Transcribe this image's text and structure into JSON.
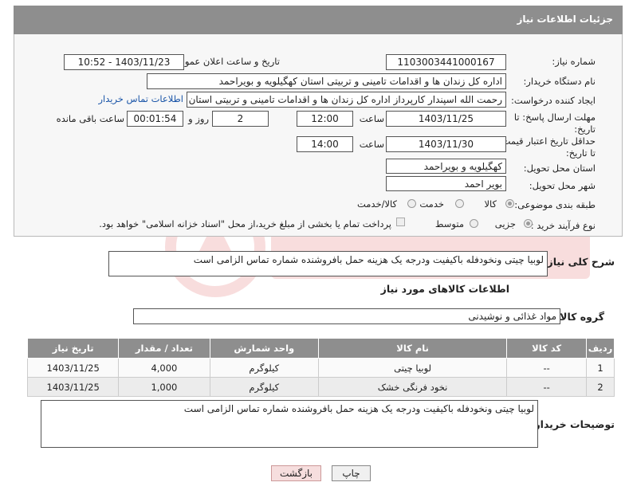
{
  "header": {
    "title": "جزئیات اطلاعات نیاز"
  },
  "form": {
    "need_number_label": "شماره نیاز:",
    "need_number": "1103003441000167",
    "announce_label": "تاریخ و ساعت اعلان عمومی:",
    "announce_value": "1403/11/23 - 10:52",
    "buyer_org_label": "نام دستگاه خریدار:",
    "buyer_org": "اداره کل زندان ها و اقدامات تامینی و تربیتی استان کهگیلویه و بویراحمد",
    "requester_label": "ایجاد کننده درخواست:",
    "requester": "رحمت الله اسپندار کارپرداز اداره کل زندان ها و اقدامات تامینی و تربیتی استان کهگیلویه و بویراحمد",
    "contact_link": "اطلاعات تماس خریدار",
    "reply_deadline_label": "مهلت ارسال پاسخ: تا تاریخ:",
    "reply_date": "1403/11/25",
    "time_label": "ساعت",
    "reply_time": "12:00",
    "days_value": "2",
    "days_label": "روز و",
    "remaining_time": "00:01:54",
    "remaining_label": "ساعت باقی مانده",
    "validity_label": "حداقل تاریخ اعتبار قیمت: تا تاریخ:",
    "validity_date": "1403/11/30",
    "time_label2": "ساعت",
    "validity_time": "14:00",
    "province_label": "استان محل تحویل:",
    "province": "کهگیلویه و بویراحمد",
    "city_label": "شهر محل تحویل:",
    "city": "بویر احمد",
    "category_label": "طبقه بندی موضوعی:",
    "category_options": [
      "کالا",
      "خدمت",
      "کالا/خدمت"
    ],
    "process_label": "نوع فرآیند خرید :",
    "process_options": [
      "جزیی",
      "متوسط"
    ],
    "payment_note": "پرداخت تمام یا بخشی از مبلغ خرید،از محل \"اسناد خزانه اسلامی\" خواهد بود."
  },
  "description": {
    "label": "شرح کلی نیاز:",
    "text": "لوبیا چیتی ونخودفله    باکیفیت ودرجه یک هزینه حمل بافروشنده شماره تماس الزامی است"
  },
  "goods": {
    "section_title": "اطلاعات کالاهای مورد نیاز",
    "group_label": "گروه کالا:",
    "group_value": "مواد غذائی و نوشیدنی",
    "columns": [
      "ردیف",
      "کد کالا",
      "نام کالا",
      "واحد شمارش",
      "تعداد / مقدار",
      "تاریخ نیاز"
    ],
    "rows": [
      [
        "1",
        "--",
        "لوبیا چیتی",
        "کیلوگرم",
        "4,000",
        "1403/11/25"
      ],
      [
        "2",
        "--",
        "نخود فرنگی خشک",
        "کیلوگرم",
        "1,000",
        "1403/11/25"
      ]
    ]
  },
  "buyer_notes": {
    "label": "توضیحات خریدار:",
    "text": "لوبیا چیتی ونخودفله    باکیفیت ودرجه یک هزینه حمل بافروشنده شماره تماس الزامی است"
  },
  "buttons": {
    "print": "چاپ",
    "back": "بازگشت"
  },
  "colors": {
    "header_bg": "#8e8e8e",
    "link": "#1a55a8",
    "back_button_bg": "#f6dede"
  }
}
